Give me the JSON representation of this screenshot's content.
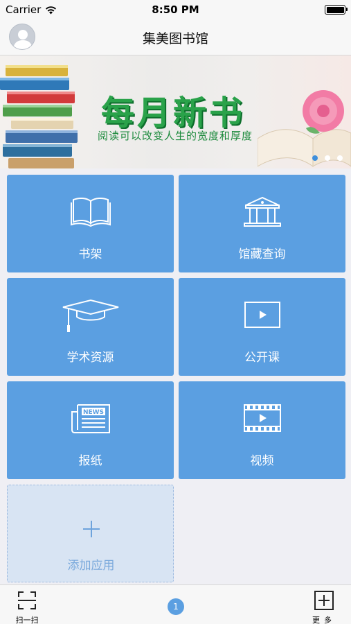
{
  "status_bar": {
    "carrier": "Carrier",
    "time": "8:50 PM"
  },
  "header": {
    "title": "集美图书馆"
  },
  "banner": {
    "title": "每月新书",
    "subtitle": "阅读可以改变人生的宽度和厚度",
    "page_count": 3,
    "active_page": 1
  },
  "tiles": [
    {
      "label": "书架",
      "icon": "open-book-icon"
    },
    {
      "label": "馆藏查询",
      "icon": "library-building-icon"
    },
    {
      "label": "学术资源",
      "icon": "graduation-cap-icon"
    },
    {
      "label": "公开课",
      "icon": "play-screen-icon"
    },
    {
      "label": "报纸",
      "icon": "newspaper-icon"
    },
    {
      "label": "视频",
      "icon": "film-play-icon"
    },
    {
      "label": "添加应用",
      "icon": "plus-icon"
    }
  ],
  "newspaper_icon_text": "NEWS",
  "tabbar": {
    "scan_label": "扫一扫",
    "page_indicator": "1",
    "more_label": "更多"
  },
  "colors": {
    "tile_blue": "#5b9fe1",
    "add_tile_bg": "#d8e4f3",
    "banner_green": "#2aa24a"
  }
}
